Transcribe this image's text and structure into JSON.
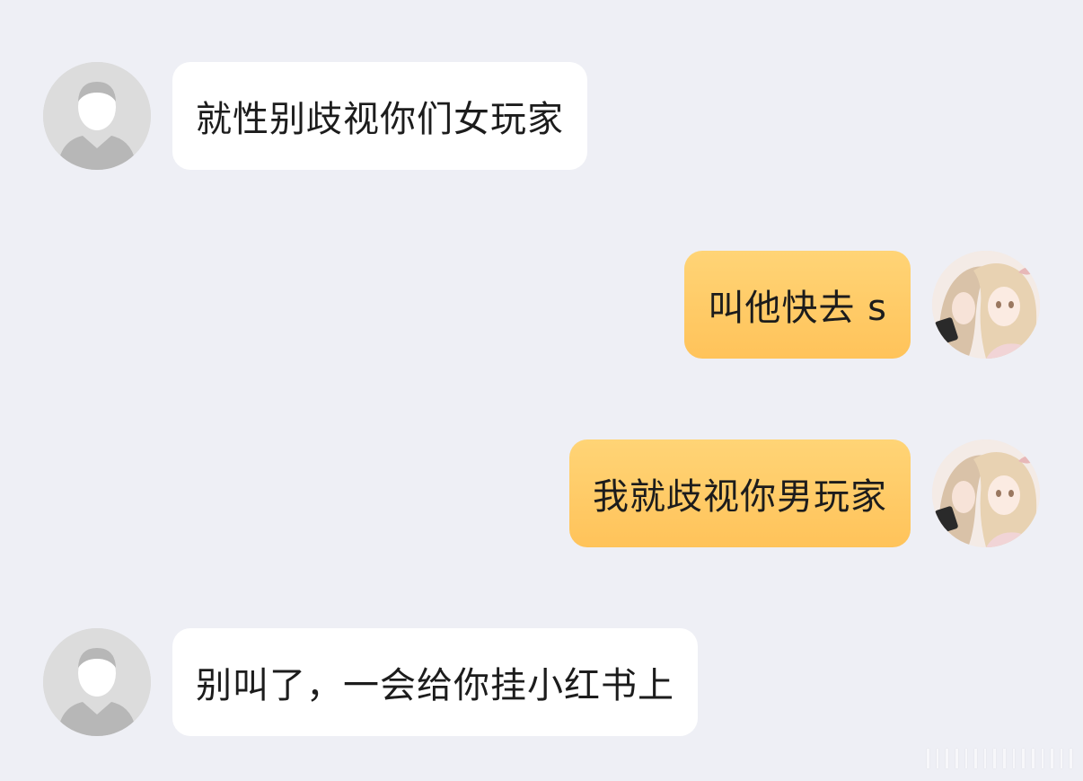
{
  "chat": {
    "messages": [
      {
        "side": "left",
        "sender": "other",
        "text": "就性别歧视你们女玩家",
        "avatar_icon": "default-user-avatar-icon"
      },
      {
        "side": "right",
        "sender": "me",
        "text": "叫他快去 s",
        "avatar_icon": "anime-girls-avatar-icon"
      },
      {
        "side": "right",
        "sender": "me",
        "text": "我就歧视你男玩家",
        "avatar_icon": "anime-girls-avatar-icon"
      },
      {
        "side": "left",
        "sender": "other",
        "text": "别叫了，一会给你挂小红书上",
        "avatar_icon": "default-user-avatar-icon"
      }
    ]
  },
  "colors": {
    "background": "#eeeff5",
    "incoming_bubble": "#ffffff",
    "outgoing_bubble": "#ffc860",
    "text": "#1c1c1c"
  }
}
